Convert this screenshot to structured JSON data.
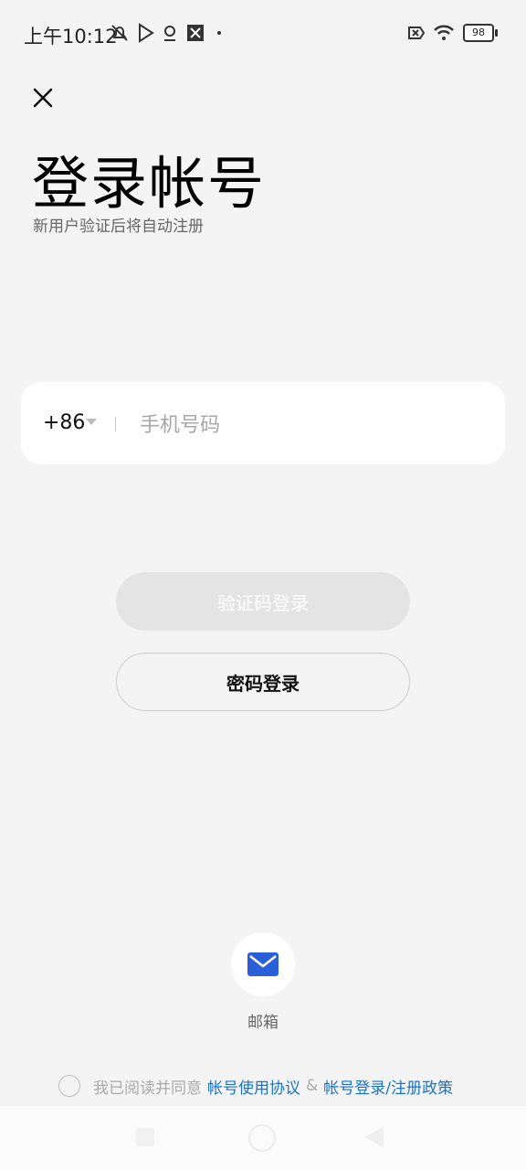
{
  "status_bar": {
    "time": "上午10:12",
    "battery": "98",
    "icons": [
      "mute-bell-icon",
      "play-store-icon",
      "location-icon",
      "app-icon",
      "dot-icon",
      "sim-x-icon",
      "wifi-icon",
      "battery-icon"
    ]
  },
  "header": {
    "close_icon": "close-icon",
    "title": "登录帐号",
    "subtitle": "新用户验证后将自动注册"
  },
  "phone": {
    "country_code": "+86",
    "placeholder": "手机号码",
    "value": ""
  },
  "buttons": {
    "code_login": "验证码登录",
    "password_login": "密码登录"
  },
  "email": {
    "icon": "mail-icon",
    "label": "邮箱",
    "accent": "#2a5fd9"
  },
  "agreement": {
    "prefix": "我已阅读并同意",
    "link1": "帐号使用协议",
    "amp": "&",
    "link2": "帐号登录/注册政策",
    "link_color": "#1a73c8"
  }
}
